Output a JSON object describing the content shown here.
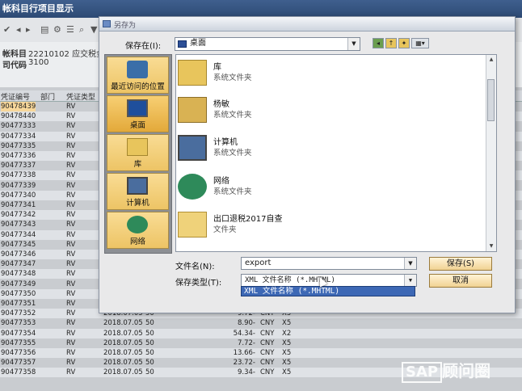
{
  "sap": {
    "title": "帐科目行项目显示",
    "header": {
      "account_label": "帐科目",
      "account_value": "22210102 应交税金",
      "company_label": "司代码",
      "company_value": "3100"
    },
    "columns": [
      "凭证编号",
      "部门",
      "凭证类型"
    ],
    "rows": [
      {
        "doc": "90478439",
        "type": "RV"
      },
      {
        "doc": "90478440",
        "type": "RV"
      },
      {
        "doc": "90477333",
        "type": "RV"
      },
      {
        "doc": "90477334",
        "type": "RV"
      },
      {
        "doc": "90477335",
        "type": "RV"
      },
      {
        "doc": "90477336",
        "type": "RV"
      },
      {
        "doc": "90477337",
        "type": "RV"
      },
      {
        "doc": "90477338",
        "type": "RV"
      },
      {
        "doc": "90477339",
        "type": "RV"
      },
      {
        "doc": "90477340",
        "type": "RV"
      },
      {
        "doc": "90477341",
        "type": "RV"
      },
      {
        "doc": "90477342",
        "type": "RV"
      },
      {
        "doc": "90477343",
        "type": "RV"
      },
      {
        "doc": "90477344",
        "type": "RV"
      },
      {
        "doc": "90477345",
        "type": "RV"
      },
      {
        "doc": "90477346",
        "type": "RV"
      },
      {
        "doc": "90477347",
        "type": "RV"
      },
      {
        "doc": "90477348",
        "type": "RV"
      },
      {
        "doc": "90477349",
        "type": "RV"
      },
      {
        "doc": "90477350",
        "type": "RV"
      },
      {
        "doc": "90477351",
        "type": "RV"
      },
      {
        "doc": "90477352",
        "type": "RV",
        "date": "2018.07.05",
        "code": "50",
        "amount": "9.72-",
        "cur": "CNY",
        "tax": "X5"
      },
      {
        "doc": "90477353",
        "type": "RV",
        "date": "2018.07.05",
        "code": "50",
        "amount": "8.90-",
        "cur": "CNY",
        "tax": "X5"
      },
      {
        "doc": "90477354",
        "type": "RV",
        "date": "2018.07.05",
        "code": "50",
        "amount": "54.34-",
        "cur": "CNY",
        "tax": "X2"
      },
      {
        "doc": "90477355",
        "type": "RV",
        "date": "2018.07.05",
        "code": "50",
        "amount": "7.72-",
        "cur": "CNY",
        "tax": "X5"
      },
      {
        "doc": "90477356",
        "type": "RV",
        "date": "2018.07.05",
        "code": "50",
        "amount": "13.66-",
        "cur": "CNY",
        "tax": "X5"
      },
      {
        "doc": "90477357",
        "type": "RV",
        "date": "2018.07.05",
        "code": "50",
        "amount": "23.72-",
        "cur": "CNY",
        "tax": "X5"
      },
      {
        "doc": "90477358",
        "type": "RV",
        "date": "2018.07.05",
        "code": "50",
        "amount": "9.34-",
        "cur": "CNY",
        "tax": "X5"
      }
    ]
  },
  "dialog": {
    "title": "另存为",
    "save_in_label": "保存在(I):",
    "save_in_value": "桌面",
    "places": [
      {
        "label": "最近访问的位置"
      },
      {
        "label": "桌面"
      },
      {
        "label": "库"
      },
      {
        "label": "计算机"
      },
      {
        "label": "网络"
      }
    ],
    "files": [
      {
        "name": "库",
        "desc": "系统文件夹"
      },
      {
        "name": "杨敏",
        "desc": "系统文件夹"
      },
      {
        "name": "计算机",
        "desc": "系统文件夹"
      },
      {
        "name": "网络",
        "desc": "系统文件夹"
      },
      {
        "name": "出口退税2017自查",
        "desc": "文件夹"
      }
    ],
    "filename_label": "文件名(N):",
    "filename_value": "export",
    "filetype_label": "保存类型(T):",
    "filetype_value": "XML 文件名称 (*.MHTML)",
    "filetype_option": "XML 文件名称 (*.MHTML)",
    "save_button": "保存(S)",
    "cancel_button": "取消"
  },
  "watermark": {
    "box": "SAP",
    "text": "顾问圈"
  }
}
